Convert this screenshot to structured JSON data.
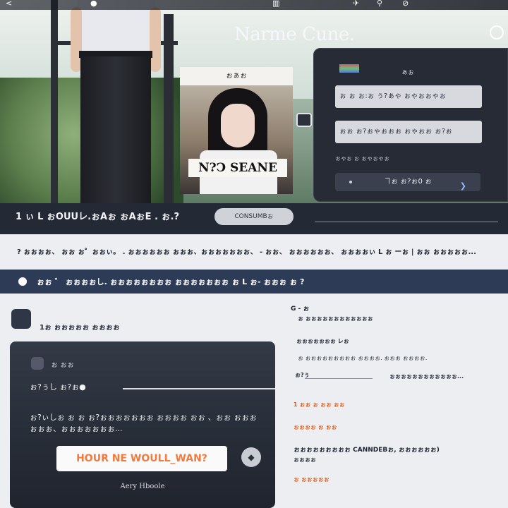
{
  "topbar": {
    "items": [
      "<",
      "●",
      "▥",
      "✈",
      "⚲",
      "⊘"
    ]
  },
  "hero": {
    "brand": "Narme Cune.",
    "poster_caption": "ぉぁぉ",
    "poster_title": "N?Ͻ SEANE"
  },
  "login": {
    "meta": "ぁぉ",
    "field_1": "ぉ ぉ ぉ:ぉ ぅ?ぁゃ ぉゃぉぉゃぉ",
    "field_2": "ぉぉ ぉ?ぉゃぉぉぉ ぉゃぉぉ ぉ?ぉ",
    "hint": "ぉゃぉ ぉ ぉゃぉゃぉ",
    "button": "ヿぉ ぉ?ぉ0 ぉ"
  },
  "strip": {
    "text": "1 ぃ L ぉOUUレ.ぉAぉ ぉAぉE .  ぉ.?",
    "pill": "CONSUMBぉ"
  },
  "notice": "?  ぉぉぉぉ、 ぉぉ ぉ゜ぉぉぃ。 . ぉぉぉぉぉぉ ぉぉぉ、ぉぉぉぉぉぉぉ、 - ぉぉ、 ぉぉぉぉぉぉ、 ぉぉぉぉぃ L ぉ ーぉ | ぉぉ ぉぉぉぉぉ...",
  "bar": {
    "text": "ぉぉ  ゛ ぉぉぉぉし. ぉぉぉぉぉぉぉぉ  ぉぉぉぉぉぉぉ ぉ L  ぉ-  ぉぉぉ  ぉ ?"
  },
  "section": {
    "title": "1ぉ  ぉぉぉぉぉ ぉぉぉぉ"
  },
  "card": {
    "small": "ぉ ぉぉ",
    "row": "ぉ?ぅし  ぉ?ぉ●",
    "desc": "ぉ?ぃしぉ ぉ ぉ  ぉ?ぉぉぉぉぉぉぉ ぉぉぉぉ ぉぉ 、ぉぉ  ぉぉぉぉぉぉ、ぉぉぉぉぉぉぉ...",
    "cta": "HOUR NE WOULL_WAN?",
    "sign": "Aery Hboole"
  },
  "side": {
    "l1": "G - ぉ",
    "l2": "ぉ ぉぉぉぉぉぉぉぉぉぉぉぉ",
    "l3": "ぉぉぉぉぉぉぉ      レぉ",
    "l4": "ぉ ぉぉぉぉぉぉぉぉぉ ぉぉぉぉ. ぉぉぉ ぉぉぉぉ.",
    "l5": "ぉ?ぅ",
    "l6": "ぉぉぉぉぉぉぉぉぉぉぉぉ...",
    "l7": "1 ぉぉ ぉ ぉぉ ぉぉ",
    "l8": "ぉぉぉぉ  ぉ  ぉぉ",
    "l9": "ぉぉぉぉぉぉぉぉぉ CANNDEBぉ, ぉぉぉぉぉぉ)",
    "l10": "ぉぉぉぉ",
    "l11": "ぉ ぉぉぉぉぉ"
  },
  "colors": {
    "accent": "#f17a3c",
    "panel": "#262b35",
    "bar": "#2e3b56"
  }
}
